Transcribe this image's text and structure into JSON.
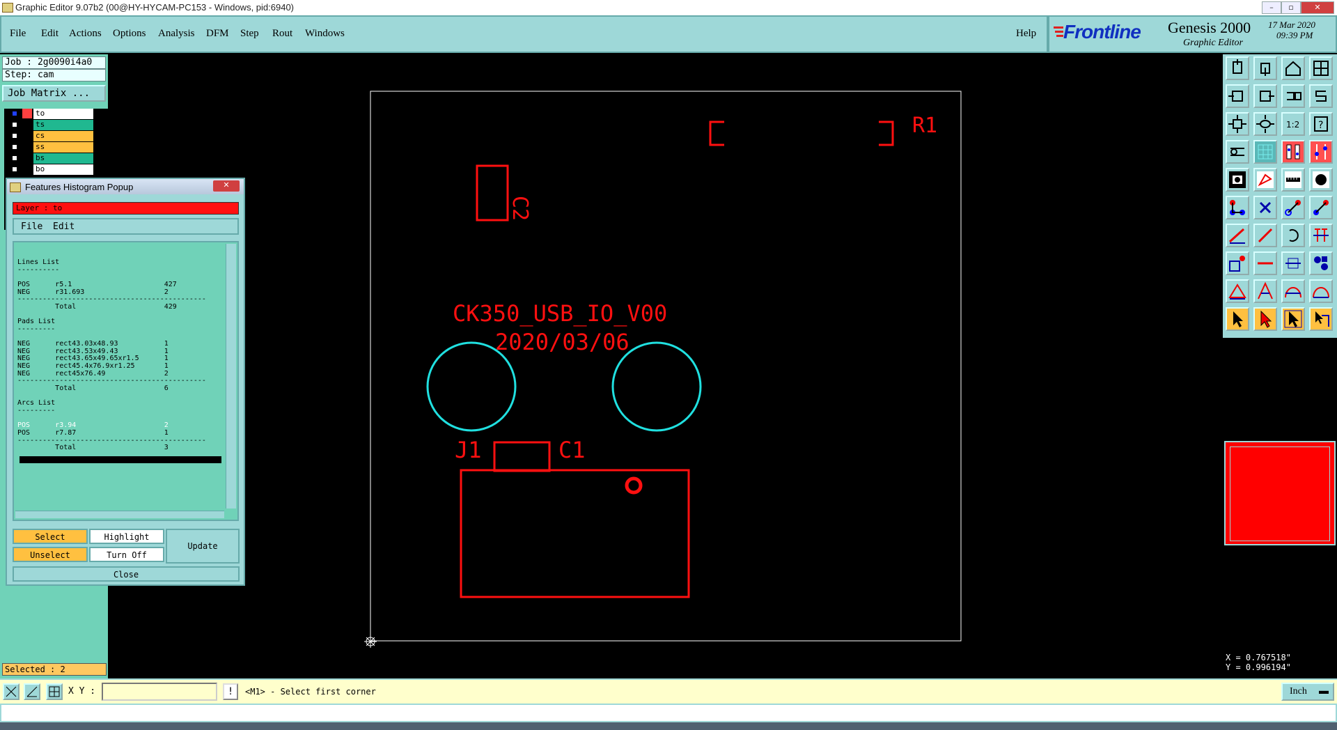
{
  "window": {
    "title": "Graphic Editor 9.07b2 (00@HY-HYCAM-PC153 - Windows, pid:6940)"
  },
  "menu": {
    "items": [
      "File",
      "Edit",
      "Actions",
      "Options",
      "Analysis",
      "DFM",
      "Step",
      "Rout",
      "Windows"
    ],
    "help": "Help"
  },
  "brand": {
    "logo": "Frontline",
    "product": "Genesis 2000",
    "subtitle": "Graphic Editor",
    "date": "17 Mar 2020",
    "time": "09:39 PM"
  },
  "job": {
    "job_label": "Job : 2g0090i4a0",
    "step_label": "Step: cam",
    "matrix_button": "Job Matrix ..."
  },
  "layers": [
    {
      "name": "to",
      "color": "#ffffff"
    },
    {
      "name": "ts",
      "color": "#20b890"
    },
    {
      "name": "cs",
      "color": "#ffc040"
    },
    {
      "name": "ss",
      "color": "#ffc040"
    },
    {
      "name": "bs",
      "color": "#20b890"
    },
    {
      "name": "bo",
      "color": "#ffffff"
    }
  ],
  "selected_label": "Selected : 2",
  "popup": {
    "title": "Features Histogram Popup",
    "layer_label": "Layer :  to",
    "menu": [
      "File",
      "Edit"
    ],
    "lines": [
      "Lines List",
      "----------",
      "",
      "POS      r5.1                      427",
      "NEG      r31.693                   2",
      "---------------------------------------------",
      "         Total                     429",
      "",
      "Pads List",
      "---------",
      "",
      "NEG      rect43.03x48.93           1",
      "NEG      rect43.53x49.43           1",
      "NEG      rect43.65x49.65xr1.5      1",
      "NEG      rect45.4x76.9xr1.25       1",
      "NEG      rect45x76.49              2",
      "---------------------------------------------",
      "         Total                     6",
      "",
      "Arcs List",
      "---------",
      "",
      "POS      r3.94                     2",
      "POS      r7.87                     1",
      "---------------------------------------------",
      "         Total                     3"
    ],
    "buttons": {
      "select": "Select",
      "highlight": "Highlight",
      "update": "Update",
      "unselect": "Unselect",
      "turn_off": "Turn Off",
      "close": "Close"
    }
  },
  "board": {
    "text_line1": "CK350_USB_IO_V00",
    "text_line2": "2020/03/06",
    "ref_r1": "R1",
    "ref_c2": "C2",
    "ref_j1": "J1",
    "ref_c1": "C1"
  },
  "coords": {
    "x": "X = 0.767518\"",
    "y": "Y = 0.996194\""
  },
  "bottom": {
    "xy_label": "X Y :",
    "xy_value": "",
    "prompt": "<M1> - Select first corner",
    "units": "Inch"
  }
}
